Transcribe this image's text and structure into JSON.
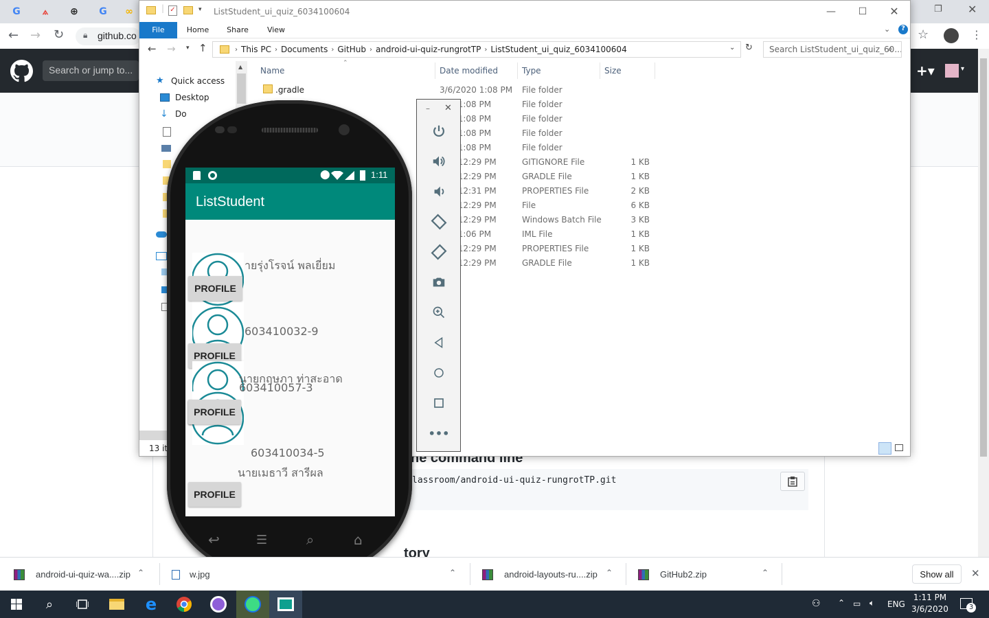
{
  "browser": {
    "omnibox_text": "github.co",
    "tab_icons": [
      "google-icon",
      "triangle-app-icon",
      "cross-app-icon",
      "google-icon",
      "link-icon"
    ]
  },
  "github": {
    "search_placeholder": "Search or jump to...",
    "command_heading": "he command line",
    "clone_url": "lassroom/android-ui-quiz-rungrotTP.git",
    "history_heading": "tory"
  },
  "explorer": {
    "title": "ListStudent_ui_quiz_6034100604",
    "ribbon_tabs": [
      "File",
      "Home",
      "Share",
      "View"
    ],
    "breadcrumb": [
      "This PC",
      "Documents",
      "GitHub",
      "android-ui-quiz-rungrotTP",
      "ListStudent_ui_quiz_6034100604"
    ],
    "search_placeholder": "Search ListStudent_ui_quiz_60...",
    "nav": [
      {
        "label": "Quick access"
      },
      {
        "label": "Desktop"
      },
      {
        "label": "Do"
      }
    ],
    "columns": {
      "name": "Name",
      "date": "Date modified",
      "type": "Type",
      "size": "Size"
    },
    "rows": [
      {
        "name": ".gradle",
        "date": "3/6/2020 1:08 PM",
        "type": "File folder",
        "size": ""
      },
      {
        "name": "",
        "date": "020 1:08 PM",
        "type": "File folder",
        "size": ""
      },
      {
        "name": "",
        "date": "020 1:08 PM",
        "type": "File folder",
        "size": ""
      },
      {
        "name": "",
        "date": "020 1:08 PM",
        "type": "File folder",
        "size": ""
      },
      {
        "name": "",
        "date": "020 1:08 PM",
        "type": "File folder",
        "size": ""
      },
      {
        "name": "",
        "date": "020 12:29 PM",
        "type": "GITIGNORE File",
        "size": "1 KB"
      },
      {
        "name": "",
        "date": "020 12:29 PM",
        "type": "GRADLE File",
        "size": "1 KB"
      },
      {
        "name": "",
        "date": "020 12:31 PM",
        "type": "PROPERTIES File",
        "size": "2 KB"
      },
      {
        "name": "",
        "date": "020 12:29 PM",
        "type": "File",
        "size": "6 KB"
      },
      {
        "name": "",
        "date": "020 12:29 PM",
        "type": "Windows Batch File",
        "size": "3 KB"
      },
      {
        "name": "",
        "date": "020 1:06 PM",
        "type": "IML File",
        "size": "1 KB"
      },
      {
        "name": "",
        "date": "020 12:29 PM",
        "type": "PROPERTIES File",
        "size": "1 KB"
      },
      {
        "name": "",
        "date": "020 12:29 PM",
        "type": "GRADLE File",
        "size": "1 KB"
      }
    ],
    "status_text": "13 ite"
  },
  "emulator": {
    "tools": [
      "power-icon",
      "volume-up-icon",
      "volume-down-icon",
      "rotate-left-icon",
      "rotate-right-icon",
      "camera-icon",
      "zoom-icon",
      "back-icon",
      "home-icon",
      "overview-icon",
      "more-icon"
    ],
    "time": "1:11",
    "app_title": "ListStudent",
    "profile_label": "PROFILE",
    "students": [
      {
        "name": "ายรุ่งโรจน์  พลเยี่ยม",
        "id": ""
      },
      {
        "name": "",
        "id": "603410032-9"
      },
      {
        "name": "นายกฤษภา  ท่าสะอาด",
        "id": "603410057-3"
      },
      {
        "name": "นายเมธาวี สารีผล",
        "id": "603410034-5"
      }
    ]
  },
  "downloads": {
    "items": [
      "android-ui-quiz-wa....zip",
      "w.jpg",
      "android-layouts-ru....zip",
      "GitHub2.zip"
    ],
    "show_all": "Show all"
  },
  "taskbar": {
    "lang": "ENG",
    "time": "1:11 PM",
    "date": "3/6/2020",
    "notification_count": "3"
  },
  "colors": {
    "app_primary": "#00897b",
    "app_primary_dark": "#00695c",
    "avatar_teal": "#1a8a96",
    "ribbon_file": "#1979ca"
  }
}
